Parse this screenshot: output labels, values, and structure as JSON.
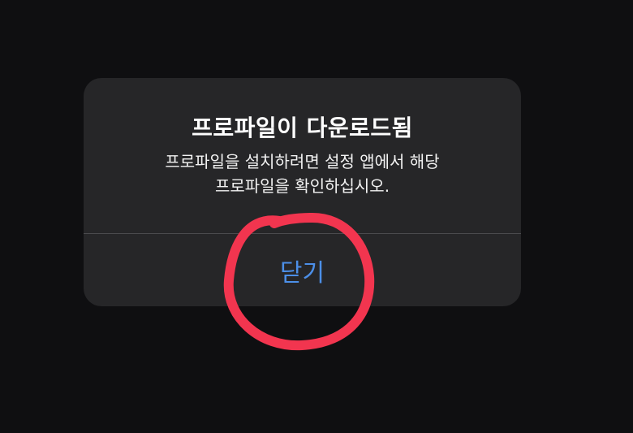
{
  "alert": {
    "title": "프로파일이 다운로드됨",
    "message_line1": "프로파일을 설치하려면 설정 앱에서 해당",
    "message_line2": "프로파일을 확인하십시오.",
    "close_label": "닫기"
  },
  "colors": {
    "background": "#0f0f11",
    "alert_background": "#262628",
    "button_text": "#4c8fe8",
    "annotation_circle": "#f2354f"
  }
}
